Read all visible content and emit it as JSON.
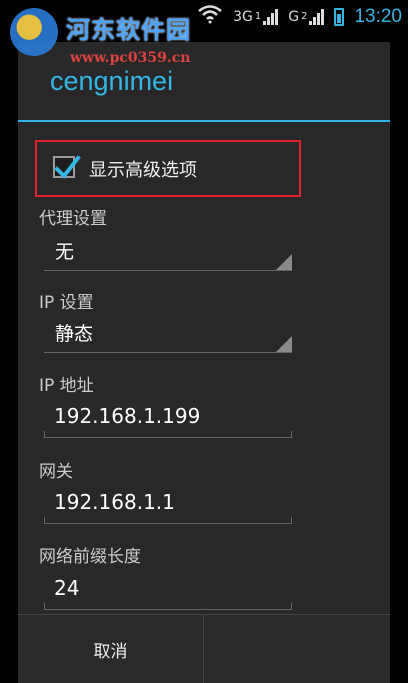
{
  "status_bar": {
    "network1": "3G",
    "network1_sup": "1",
    "network2": "G",
    "network2_sup": "2",
    "time": "13:20"
  },
  "watermark": {
    "title": "河东软件园",
    "url": "www.pc0359.cn"
  },
  "dialog": {
    "title": "cengnimei",
    "advanced_option": {
      "label": "显示高级选项",
      "checked": true
    },
    "proxy": {
      "label": "代理设置",
      "value": "无"
    },
    "ip_settings": {
      "label": "IP 设置",
      "value": "静态"
    },
    "ip_address": {
      "label": "IP 地址",
      "value": "192.168.1.199"
    },
    "gateway": {
      "label": "网关",
      "value": "192.168.1.1"
    },
    "prefix_length": {
      "label": "网络前缀长度",
      "value": "24"
    },
    "buttons": {
      "cancel": "取消"
    }
  },
  "colors": {
    "accent": "#33b5e5",
    "highlight_border": "#e0202a"
  }
}
